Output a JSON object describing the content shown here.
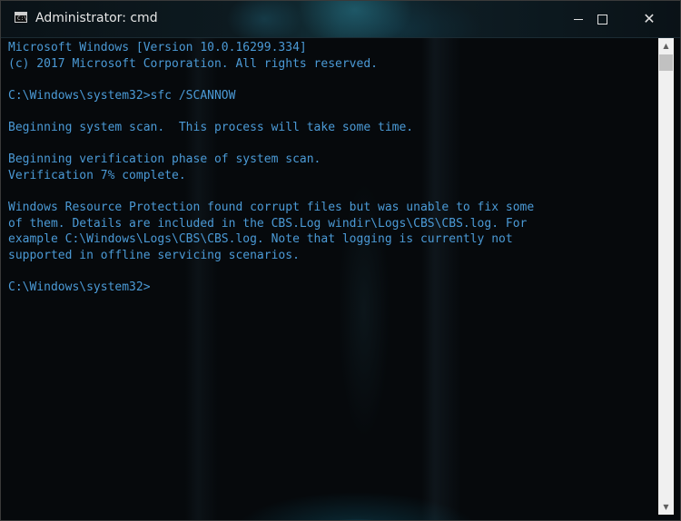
{
  "window": {
    "title": "Administrator: cmd",
    "icon": "cmd-console-icon",
    "controls": {
      "minimize": "minimize-icon",
      "maximize": "maximize-icon",
      "close": "close-icon",
      "close_glyph": "✕"
    }
  },
  "console": {
    "text_color": "#4b9ad6",
    "lines": [
      "Microsoft Windows [Version 10.0.16299.334]",
      "(c) 2017 Microsoft Corporation. All rights reserved.",
      "",
      "C:\\Windows\\system32>sfc /SCANNOW",
      "",
      "Beginning system scan.  This process will take some time.",
      "",
      "Beginning verification phase of system scan.",
      "Verification 7% complete.",
      "",
      "Windows Resource Protection found corrupt files but was unable to fix some",
      "of them. Details are included in the CBS.Log windir\\Logs\\CBS\\CBS.log. For",
      "example C:\\Windows\\Logs\\CBS\\CBS.log. Note that logging is currently not",
      "supported in offline servicing scenarios.",
      "",
      "C:\\Windows\\system32>"
    ]
  },
  "scrollbar": {
    "up_arrow": "▲",
    "down_arrow": "▼"
  }
}
